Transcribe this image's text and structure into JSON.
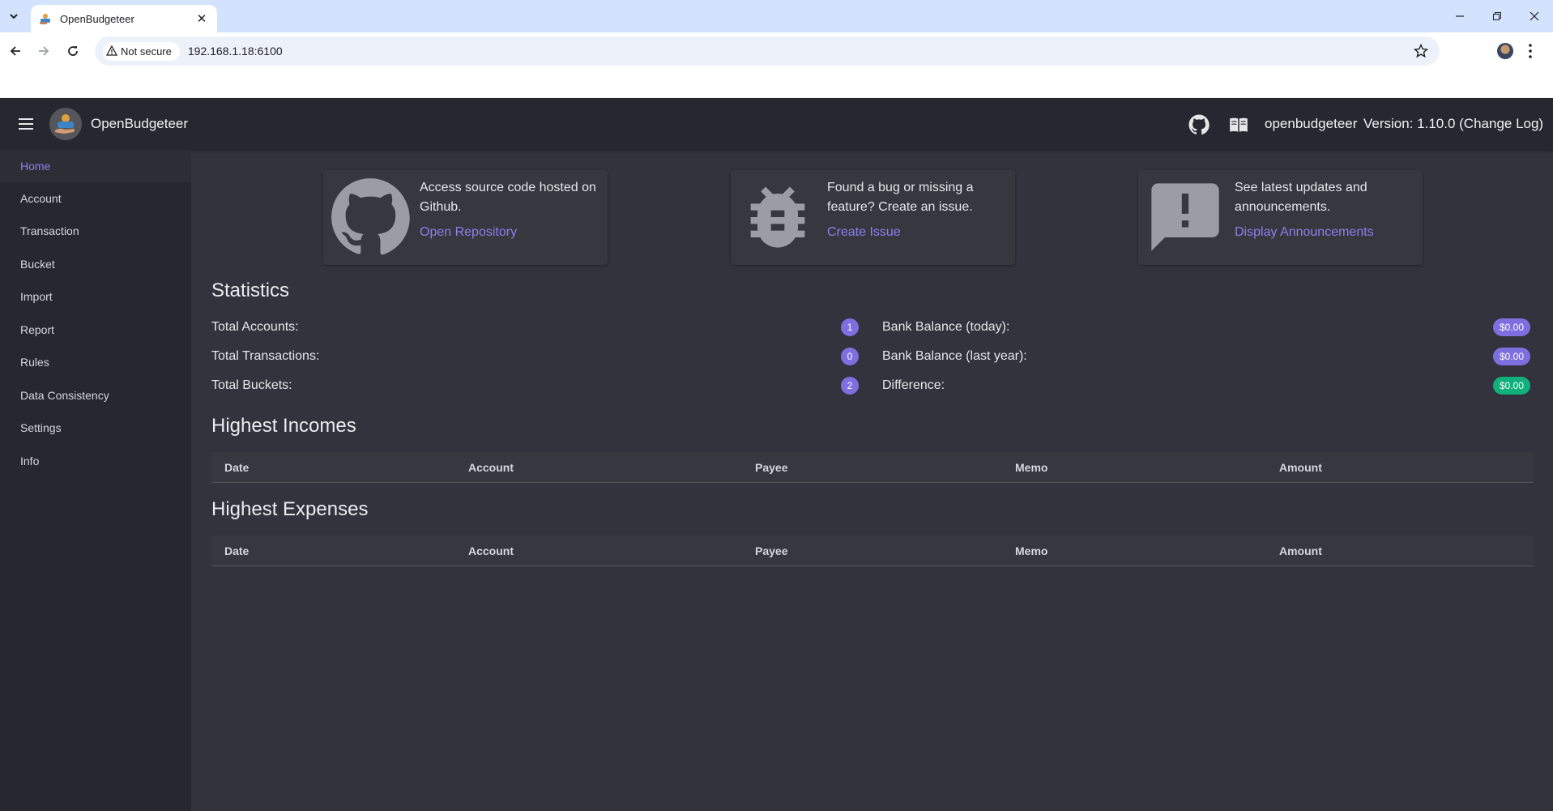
{
  "browser": {
    "tab_title": "OpenBudgeteer",
    "security_label": "Not secure",
    "url": "192.168.1.18:6100"
  },
  "appbar": {
    "title": "OpenBudgeteer",
    "username": "openbudgeteer",
    "version": "Version: 1.10.0 (Change Log)"
  },
  "sidebar": {
    "items": [
      {
        "label": "Home"
      },
      {
        "label": "Account"
      },
      {
        "label": "Transaction"
      },
      {
        "label": "Bucket"
      },
      {
        "label": "Import"
      },
      {
        "label": "Report"
      },
      {
        "label": "Rules"
      },
      {
        "label": "Data Consistency"
      },
      {
        "label": "Settings"
      },
      {
        "label": "Info"
      }
    ]
  },
  "cards": [
    {
      "icon": "github-icon",
      "text": "Access source code hosted on Github.",
      "link": "Open Repository"
    },
    {
      "icon": "bug-icon",
      "text": "Found a bug or missing a feature? Create an issue.",
      "link": "Create Issue"
    },
    {
      "icon": "announcement-icon",
      "text": "See latest updates and announcements.",
      "link": "Display Announcements"
    }
  ],
  "statistics": {
    "title": "Statistics",
    "total_accounts_label": "Total Accounts:",
    "total_accounts_value": "1",
    "total_transactions_label": "Total Transactions:",
    "total_transactions_value": "0",
    "total_buckets_label": "Total Buckets:",
    "total_buckets_value": "2",
    "bank_balance_today_label": "Bank Balance (today):",
    "bank_balance_today_value": "$0.00",
    "bank_balance_last_year_label": "Bank Balance (last year):",
    "bank_balance_last_year_value": "$0.00",
    "difference_label": "Difference:",
    "difference_value": "$0.00"
  },
  "incomes": {
    "title": "Highest Incomes",
    "columns": [
      "Date",
      "Account",
      "Payee",
      "Memo",
      "Amount"
    ]
  },
  "expenses": {
    "title": "Highest Expenses",
    "columns": [
      "Date",
      "Account",
      "Payee",
      "Memo",
      "Amount"
    ]
  },
  "colors": {
    "accent": "#7e6fe0",
    "link": "#8b7fee",
    "success": "#10b07a",
    "appbar": "#27272f",
    "background": "#32333d"
  }
}
